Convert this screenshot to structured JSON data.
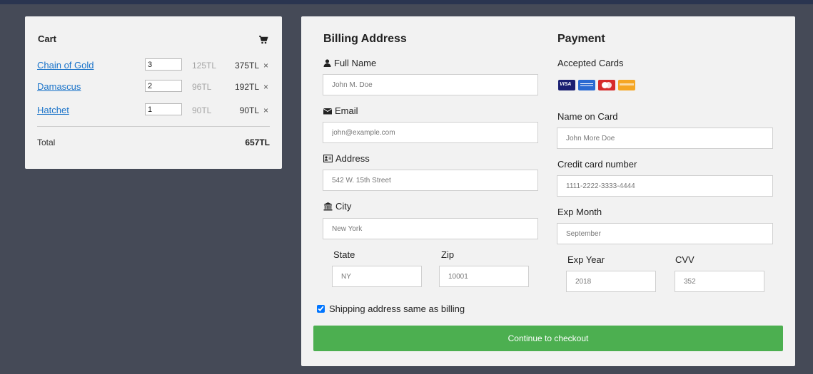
{
  "cart": {
    "title": "Cart",
    "icon": "shopping-cart-icon",
    "items": [
      {
        "name": "Chain of Gold",
        "qty": "3",
        "price": "125TL",
        "subtotal": "375TL",
        "remove": "×"
      },
      {
        "name": "Damascus",
        "qty": "2",
        "price": "96TL",
        "subtotal": "192TL",
        "remove": "×"
      },
      {
        "name": "Hatchet",
        "qty": "1",
        "price": "90TL",
        "subtotal": "90TL",
        "remove": "×"
      }
    ],
    "total_label": "Total",
    "total_value": "657TL"
  },
  "billing": {
    "title": "Billing Address",
    "full_name_label": "Full Name",
    "full_name_placeholder": "John M. Doe",
    "email_label": "Email",
    "email_placeholder": "john@example.com",
    "address_label": "Address",
    "address_placeholder": "542 W. 15th Street",
    "city_label": "City",
    "city_placeholder": "New York",
    "state_label": "State",
    "state_placeholder": "NY",
    "zip_label": "Zip",
    "zip_placeholder": "10001"
  },
  "payment": {
    "title": "Payment",
    "accepted_cards_label": "Accepted Cards",
    "name_on_card_label": "Name on Card",
    "name_on_card_placeholder": "John More Doe",
    "cc_number_label": "Credit card number",
    "cc_number_placeholder": "1111-2222-3333-4444",
    "exp_month_label": "Exp Month",
    "exp_month_placeholder": "September",
    "exp_year_label": "Exp Year",
    "exp_year_placeholder": "2018",
    "cvv_label": "CVV",
    "cvv_placeholder": "352"
  },
  "shipping_same_label": "Shipping address same as billing",
  "shipping_same_checked": true,
  "continue_button": "Continue to checkout",
  "colors": {
    "background": "#454a57",
    "panel": "#f2f2f2",
    "link": "#1a73c9",
    "button": "#4caf50"
  }
}
